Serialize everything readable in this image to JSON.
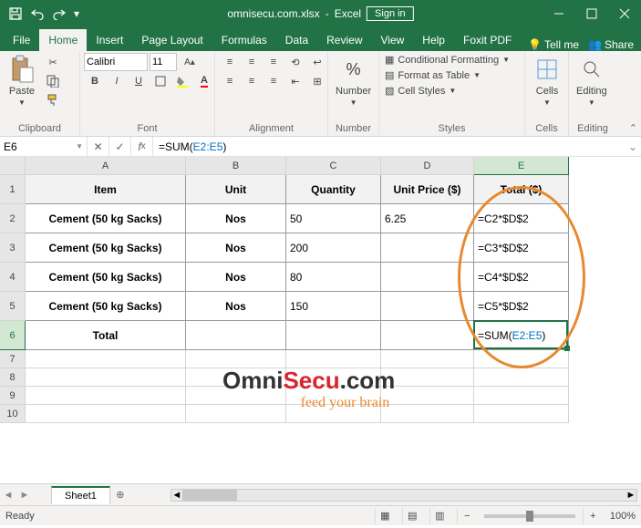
{
  "titlebar": {
    "filename": "omnisecu.com.xlsx",
    "app": "Excel",
    "signin": "Sign in"
  },
  "tabs": {
    "file": "File",
    "home": "Home",
    "insert": "Insert",
    "pagelayout": "Page Layout",
    "formulas": "Formulas",
    "data": "Data",
    "review": "Review",
    "view": "View",
    "help": "Help",
    "foxit": "Foxit PDF",
    "tellme": "Tell me",
    "share": "Share"
  },
  "ribbon": {
    "clipboardLabel": "Clipboard",
    "pasteLabel": "Paste",
    "fontLabel": "Font",
    "fontName": "Calibri",
    "fontSize": "11",
    "alignLabel": "Alignment",
    "numberLabel": "Number",
    "numberBtn": "Number",
    "stylesLabel": "Styles",
    "condFmt": "Conditional Formatting",
    "fmtTable": "Format as Table",
    "cellStyles": "Cell Styles",
    "cellsLabel": "Cells",
    "cellsBtn": "Cells",
    "editingLabel": "Editing",
    "editingBtn": "Editing"
  },
  "namebox": "E6",
  "formula": {
    "prefix": "=SUM(",
    "ref": "E2:E5",
    "suffix": ")"
  },
  "cols": {
    "A": "A",
    "B": "B",
    "C": "C",
    "D": "D",
    "E": "E"
  },
  "rows": [
    "1",
    "2",
    "3",
    "4",
    "5",
    "6",
    "7",
    "8",
    "9",
    "10"
  ],
  "headers": {
    "item": "Item",
    "unit": "Unit",
    "qty": "Quantity",
    "price": "Unit Price ($)",
    "total": "Total ($)"
  },
  "data": [
    {
      "item": "Cement (50 kg Sacks)",
      "unit": "Nos",
      "qty": "50",
      "price": "6.25",
      "total": "=C2*$D$2"
    },
    {
      "item": "Cement (50 kg Sacks)",
      "unit": "Nos",
      "qty": "200",
      "price": "",
      "total": "=C3*$D$2"
    },
    {
      "item": "Cement (50 kg Sacks)",
      "unit": "Nos",
      "qty": "80",
      "price": "",
      "total": "=C4*$D$2"
    },
    {
      "item": "Cement (50 kg Sacks)",
      "unit": "Nos",
      "qty": "150",
      "price": "",
      "total": "=C5*$D$2"
    }
  ],
  "totalRow": {
    "label": "Total",
    "formulaPrefix": "=SUM(",
    "formulaRef": "E2:E5",
    "formulaSuffix": ")"
  },
  "sheet": {
    "name": "Sheet1"
  },
  "status": {
    "ready": "Ready",
    "zoom": "100%"
  },
  "watermark": {
    "omni": "Omni",
    "secu": "Secu",
    "dotcom": ".com",
    "tag": "feed your brain"
  },
  "colWidths": {
    "A": 176,
    "B": 110,
    "C": 104,
    "D": 102,
    "E": 104
  },
  "rowHeights": {
    "hdr": 32,
    "data": 32,
    "rest": 20
  }
}
